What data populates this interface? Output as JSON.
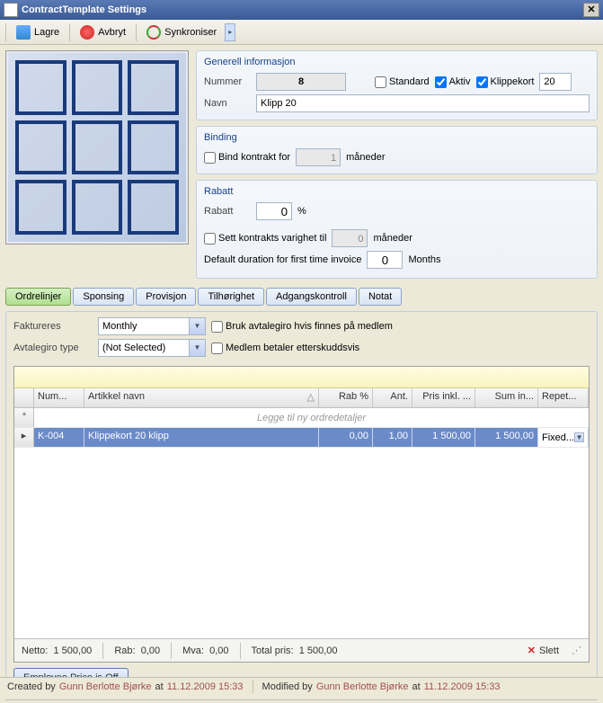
{
  "window": {
    "title": "ContractTemplate Settings"
  },
  "toolbar": {
    "save": "Lagre",
    "cancel": "Avbryt",
    "sync": "Synkroniser"
  },
  "general": {
    "title": "Generell informasjon",
    "number_label": "Nummer",
    "number": "8",
    "standard_label": "Standard",
    "standard": false,
    "active_label": "Aktiv",
    "active": true,
    "klippekort_label": "Klippekort",
    "klippekort": true,
    "klippekort_value": "20",
    "name_label": "Navn",
    "name": "Klipp 20"
  },
  "binding": {
    "title": "Binding",
    "bind_label": "Bind kontrakt for",
    "bind_checked": false,
    "months_value": "1",
    "months_suffix": "måneder"
  },
  "rabatt": {
    "title": "Rabatt",
    "rabatt_label": "Rabatt",
    "rabatt_value": "0",
    "rabatt_suffix": "%",
    "set_duration_label": "Sett kontrakts varighet til",
    "set_duration_checked": false,
    "set_duration_value": "0",
    "set_duration_suffix": "måneder",
    "default_duration_label": "Default duration for first time invoice",
    "default_duration_value": "0",
    "default_duration_suffix": "Months"
  },
  "tabs": [
    "Ordrelinjer",
    "Sponsing",
    "Provisjon",
    "Tilhørighet",
    "Adgangskontroll",
    "Notat"
  ],
  "active_tab": 0,
  "subform": {
    "faktureres_label": "Faktureres",
    "faktureres_value": "Monthly",
    "avtalegiro_type_label": "Avtalegiro type",
    "avtalegiro_type_value": "(Not Selected)",
    "use_avtalegiro_label": "Bruk avtalegiro hvis finnes på medlem",
    "use_avtalegiro": false,
    "etterskudd_label": "Medlem betaler etterskuddsvis",
    "etterskudd": false
  },
  "grid": {
    "columns": [
      "Num...",
      "Artikkel navn",
      "Rab %",
      "Ant.",
      "Pris inkl. ...",
      "Sum in...",
      "Repet..."
    ],
    "new_row_text": "Legge til ny ordredetaljer",
    "rows": [
      {
        "num": "K-004",
        "name": "Klippekort  20 klipp",
        "rab": "0,00",
        "ant": "1,00",
        "pris": "1 500,00",
        "sum": "1 500,00",
        "rep": "Fixed..."
      }
    ],
    "footer": {
      "netto_label": "Netto:",
      "netto": "1 500,00",
      "rab_label": "Rab:",
      "rab": "0,00",
      "mva_label": "Mva:",
      "mva": "0,00",
      "total_label": "Total pris:",
      "total": "1 500,00",
      "delete": "Slett"
    }
  },
  "emp_price_btn": "Employee Price is Off",
  "status": {
    "created_by_label": "Created by",
    "created_by": "Gunn Berlotte Bjørke",
    "created_at_label": "at",
    "created_at": "11.12.2009 15:33",
    "modified_by_label": "Modified by",
    "modified_by": "Gunn Berlotte Bjørke",
    "modified_at_label": "at",
    "modified_at": "11.12.2009 15:33"
  }
}
